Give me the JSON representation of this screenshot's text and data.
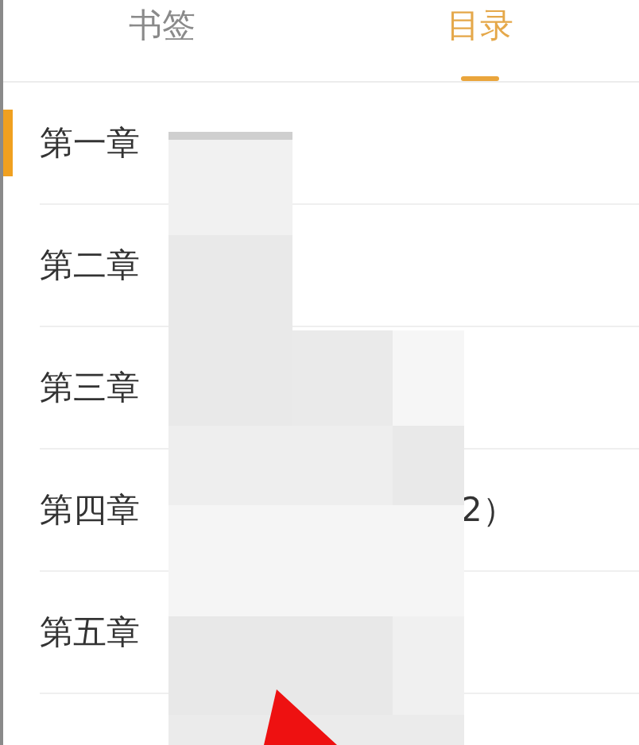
{
  "tabs": [
    {
      "label": "书签",
      "selected": false
    },
    {
      "label": "目录",
      "selected": true
    }
  ],
  "chapters": [
    {
      "title": "第一章",
      "selected": true
    },
    {
      "title": "第二章",
      "selected": false
    },
    {
      "title": "第三章",
      "selected": false
    },
    {
      "title": "第四章",
      "selected": false,
      "suffix": "2）"
    },
    {
      "title": "第五章",
      "selected": false
    }
  ]
}
